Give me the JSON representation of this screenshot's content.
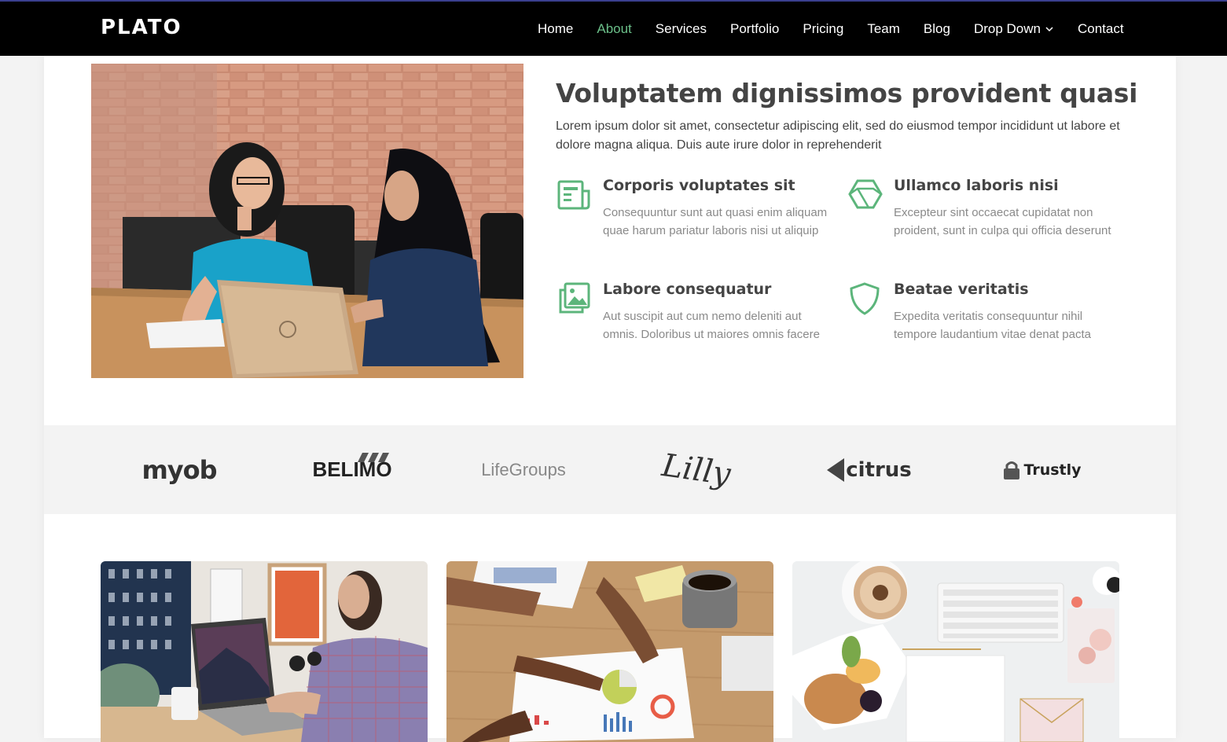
{
  "brand": {
    "logo": "PLATO"
  },
  "nav": {
    "items": [
      {
        "label": "Home",
        "active": false
      },
      {
        "label": "About",
        "active": true
      },
      {
        "label": "Services",
        "active": false
      },
      {
        "label": "Portfolio",
        "active": false
      },
      {
        "label": "Pricing",
        "active": false
      },
      {
        "label": "Team",
        "active": false
      },
      {
        "label": "Blog",
        "active": false
      },
      {
        "label": "Drop Down",
        "active": false,
        "dropdown": true
      },
      {
        "label": "Contact",
        "active": false
      }
    ],
    "active_color": "#6bbf89"
  },
  "about": {
    "title": "Voluptatem dignissimos provident quasi",
    "lead": "Lorem ipsum dolor sit amet, consectetur adipiscing elit, sed do eiusmod tempor incididunt ut labore et dolore magna aliqua. Duis aute irure dolor in reprehenderit",
    "features": [
      {
        "icon": "newspaper-icon",
        "title": "Corporis voluptates sit",
        "desc": "Consequuntur sunt aut quasi enim aliquam quae harum pariatur laboris nisi ut aliquip"
      },
      {
        "icon": "cube-icon",
        "title": "Ullamco laboris nisi",
        "desc": "Excepteur sint occaecat cupidatat non proident, sunt in culpa qui officia deserunt"
      },
      {
        "icon": "images-icon",
        "title": "Labore consequatur",
        "desc": "Aut suscipit aut cum nemo deleniti aut omnis. Doloribus ut maiores omnis facere"
      },
      {
        "icon": "shield-icon",
        "title": "Beatae veritatis",
        "desc": "Expedita veritatis consequuntur nihil tempore laudantium vitae denat pacta"
      }
    ],
    "accent_color": "#5cb57b"
  },
  "clients": {
    "logos": [
      "myob",
      "BELIMO",
      "LifeGroups",
      "Lilly",
      "citrus",
      "Trustly"
    ]
  },
  "colors": {
    "header_bg": "#000000",
    "page_bg": "#f3f3f3",
    "card_bg": "#ffffff"
  }
}
